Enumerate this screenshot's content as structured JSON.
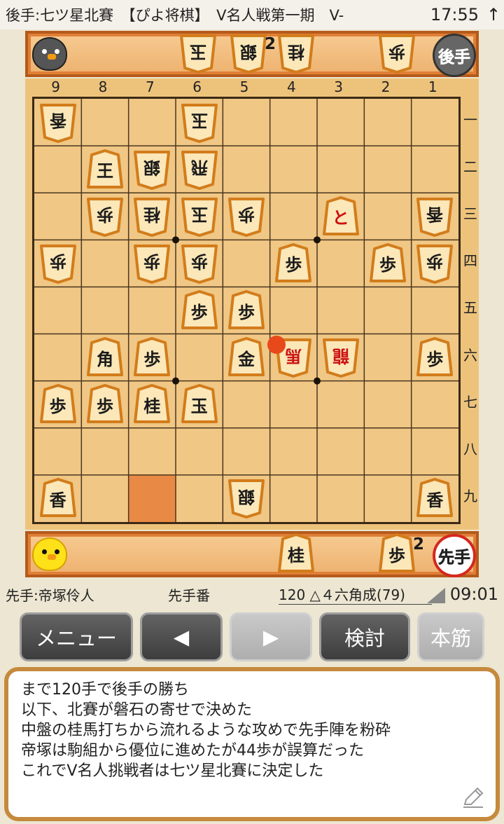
{
  "status_bar": {
    "title": "後手:七ツ星北賽　【ぴよ将棋】　V名人戦第一期　V-",
    "clock": "17:55",
    "arrow": "↑"
  },
  "gote": {
    "seal": "後手",
    "hand": [
      {
        "label": "玉",
        "count": ""
      },
      {
        "label": "銀",
        "count": "2"
      },
      {
        "label": "桂",
        "count": ""
      },
      {
        "label": "歩",
        "count": ""
      }
    ]
  },
  "sente": {
    "seal": "先手",
    "hand": [
      {
        "label": "桂",
        "count": ""
      },
      {
        "label": "歩",
        "count": "2"
      }
    ]
  },
  "board": {
    "files": [
      "9",
      "8",
      "7",
      "6",
      "5",
      "4",
      "3",
      "2",
      "1"
    ],
    "ranks": [
      "一",
      "二",
      "三",
      "四",
      "五",
      "六",
      "七",
      "八",
      "九"
    ],
    "highlight": {
      "file": 7,
      "rank": 9,
      "color": "#e88a45"
    },
    "last_move_marker": {
      "file": 4,
      "rank": 6,
      "color": "#e8491b"
    },
    "pieces": [
      {
        "file": 9,
        "rank": 1,
        "label": "香",
        "owner": "gote"
      },
      {
        "file": 6,
        "rank": 1,
        "label": "玉",
        "owner": "gote"
      },
      {
        "file": 8,
        "rank": 2,
        "label": "王",
        "owner": "sente"
      },
      {
        "file": 7,
        "rank": 2,
        "label": "銀",
        "owner": "gote"
      },
      {
        "file": 6,
        "rank": 2,
        "label": "飛",
        "owner": "gote"
      },
      {
        "file": 8,
        "rank": 3,
        "label": "歩",
        "owner": "gote"
      },
      {
        "file": 7,
        "rank": 3,
        "label": "桂",
        "owner": "gote"
      },
      {
        "file": 6,
        "rank": 3,
        "label": "玉",
        "owner": "gote"
      },
      {
        "file": 5,
        "rank": 3,
        "label": "歩",
        "owner": "gote"
      },
      {
        "file": 3,
        "rank": 3,
        "label": "と",
        "owner": "sente",
        "promoted": true
      },
      {
        "file": 1,
        "rank": 3,
        "label": "香",
        "owner": "gote"
      },
      {
        "file": 9,
        "rank": 4,
        "label": "歩",
        "owner": "gote"
      },
      {
        "file": 7,
        "rank": 4,
        "label": "歩",
        "owner": "gote"
      },
      {
        "file": 6,
        "rank": 4,
        "label": "歩",
        "owner": "gote"
      },
      {
        "file": 4,
        "rank": 4,
        "label": "歩",
        "owner": "sente"
      },
      {
        "file": 2,
        "rank": 4,
        "label": "歩",
        "owner": "sente"
      },
      {
        "file": 1,
        "rank": 4,
        "label": "歩",
        "owner": "gote"
      },
      {
        "file": 6,
        "rank": 5,
        "label": "歩",
        "owner": "sente"
      },
      {
        "file": 5,
        "rank": 5,
        "label": "歩",
        "owner": "sente"
      },
      {
        "file": 8,
        "rank": 6,
        "label": "角",
        "owner": "sente"
      },
      {
        "file": 7,
        "rank": 6,
        "label": "歩",
        "owner": "sente"
      },
      {
        "file": 5,
        "rank": 6,
        "label": "金",
        "owner": "sente"
      },
      {
        "file": 4,
        "rank": 6,
        "label": "馬",
        "owner": "gote",
        "promoted": true
      },
      {
        "file": 3,
        "rank": 6,
        "label": "龍",
        "owner": "gote",
        "promoted": true
      },
      {
        "file": 1,
        "rank": 6,
        "label": "歩",
        "owner": "sente"
      },
      {
        "file": 9,
        "rank": 7,
        "label": "歩",
        "owner": "sente"
      },
      {
        "file": 8,
        "rank": 7,
        "label": "歩",
        "owner": "sente"
      },
      {
        "file": 7,
        "rank": 7,
        "label": "桂",
        "owner": "sente"
      },
      {
        "file": 6,
        "rank": 7,
        "label": "玉",
        "owner": "sente"
      },
      {
        "file": 9,
        "rank": 9,
        "label": "香",
        "owner": "sente"
      },
      {
        "file": 5,
        "rank": 9,
        "label": "銀",
        "owner": "gote"
      },
      {
        "file": 1,
        "rank": 9,
        "label": "香",
        "owner": "sente"
      }
    ]
  },
  "info": {
    "sente_name": "先手:帝塚伶人",
    "turn": "先手番",
    "move_record": "120 △４六角成(79)",
    "time": "09:01"
  },
  "buttons": {
    "menu": "メニュー",
    "prev": "◀",
    "next": "▶",
    "analysis": "検討",
    "mainline": "本筋"
  },
  "comment": [
    "まで120手で後手の勝ち",
    "以下、北賽が磐石の寄せで決めた",
    "中盤の桂馬打ちから流れるような攻めで先手陣を粉砕",
    "帝塚は駒組から優位に進めたが44歩が誤算だった",
    "これでV名人挑戦者は七ツ星北賽に決定した"
  ]
}
